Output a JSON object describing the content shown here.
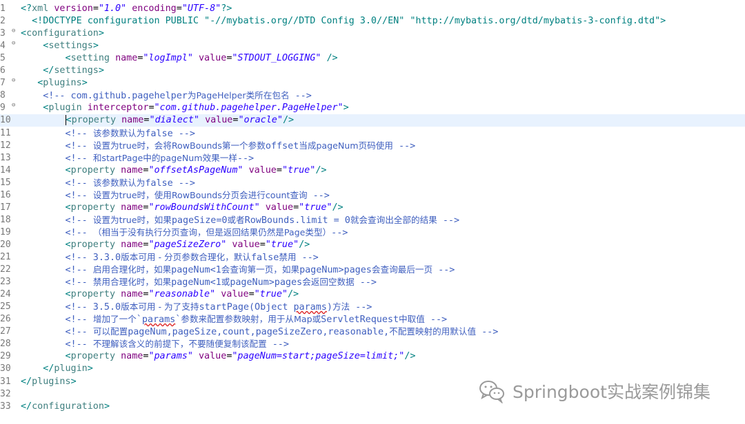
{
  "lines": [
    {
      "n": "1",
      "fold": false,
      "parts": [
        [
          "pi",
          "<?"
        ],
        [
          "tg",
          "xml "
        ],
        [
          "at",
          "version"
        ],
        [
          "tx",
          "="
        ],
        [
          "av",
          "\"1.0\""
        ],
        [
          "tx",
          " "
        ],
        [
          "at",
          "encoding"
        ],
        [
          "tx",
          "="
        ],
        [
          "av",
          "\"UTF-8\""
        ],
        [
          "pi",
          "?>"
        ]
      ]
    },
    {
      "n": "2",
      "fold": false,
      "parts": [
        [
          "tx",
          "  "
        ],
        [
          "dt",
          "<!DOCTYPE configuration PUBLIC "
        ],
        [
          "av2",
          "\"-//mybatis.org//DTD Config 3.0//EN\""
        ],
        [
          "tx",
          " "
        ],
        [
          "av2",
          "\"http://mybatis.org/dtd/mybatis-3-config.dtd\""
        ],
        [
          "dt",
          ">"
        ]
      ]
    },
    {
      "n": "3",
      "fold": true,
      "parts": [
        [
          "br",
          "<"
        ],
        [
          "tg",
          "configuration"
        ],
        [
          "br",
          ">"
        ]
      ]
    },
    {
      "n": "4",
      "fold": true,
      "parts": [
        [
          "tx",
          "    "
        ],
        [
          "br",
          "<"
        ],
        [
          "tg",
          "settings"
        ],
        [
          "br",
          ">"
        ]
      ]
    },
    {
      "n": "5",
      "fold": false,
      "parts": [
        [
          "tx",
          "        "
        ],
        [
          "br",
          "<"
        ],
        [
          "tg",
          "setting "
        ],
        [
          "at",
          "name"
        ],
        [
          "tx",
          "="
        ],
        [
          "av",
          "\"logImpl\""
        ],
        [
          "tx",
          " "
        ],
        [
          "at",
          "value"
        ],
        [
          "tx",
          "="
        ],
        [
          "av",
          "\"STDOUT_LOGGING\""
        ],
        [
          "tx",
          " "
        ],
        [
          "br",
          "/>"
        ]
      ]
    },
    {
      "n": "6",
      "fold": false,
      "parts": [
        [
          "tx",
          "    "
        ],
        [
          "br",
          "</"
        ],
        [
          "tg",
          "settings"
        ],
        [
          "br",
          ">"
        ]
      ]
    },
    {
      "n": "7",
      "fold": true,
      "parts": [
        [
          "tx",
          "   "
        ],
        [
          "br",
          "<"
        ],
        [
          "tg",
          "plugins"
        ],
        [
          "br",
          ">"
        ]
      ]
    },
    {
      "n": "8",
      "fold": false,
      "parts": [
        [
          "tx",
          "    "
        ],
        [
          "cm",
          "<!-- com.github.pagehelper"
        ],
        [
          "cmz",
          "为PageHelper类所在包名"
        ],
        [
          "cm",
          " -->"
        ]
      ]
    },
    {
      "n": "9",
      "fold": true,
      "parts": [
        [
          "tx",
          "    "
        ],
        [
          "br",
          "<"
        ],
        [
          "tg",
          "plugin "
        ],
        [
          "at",
          "interceptor"
        ],
        [
          "tx",
          "="
        ],
        [
          "av",
          "\"com.github.pagehelper.PageHelper\""
        ],
        [
          "br",
          ">"
        ]
      ]
    },
    {
      "n": "10",
      "fold": false,
      "current": true,
      "parts": [
        [
          "tx",
          "        "
        ],
        [
          "caret",
          ""
        ],
        [
          "br",
          "<"
        ],
        [
          "tg",
          "property "
        ],
        [
          "at",
          "name"
        ],
        [
          "tx",
          "="
        ],
        [
          "av",
          "\"dialect\""
        ],
        [
          "tx",
          " "
        ],
        [
          "at",
          "value"
        ],
        [
          "tx",
          "="
        ],
        [
          "av",
          "\"oracle\""
        ],
        [
          "br",
          "/>"
        ]
      ]
    },
    {
      "n": "11",
      "fold": false,
      "parts": [
        [
          "tx",
          "        "
        ],
        [
          "cm",
          "<!-- "
        ],
        [
          "cmz",
          "该参数默认为"
        ],
        [
          "cm",
          "false -->"
        ]
      ]
    },
    {
      "n": "12",
      "fold": false,
      "parts": [
        [
          "tx",
          "        "
        ],
        [
          "cm",
          "<!-- "
        ],
        [
          "cmz",
          "设置为true时，会将RowBounds第一个参数"
        ],
        [
          "cm",
          "offset"
        ],
        [
          "cmz",
          "当成pageNum页码使用"
        ],
        [
          "cm",
          " -->"
        ]
      ]
    },
    {
      "n": "13",
      "fold": false,
      "parts": [
        [
          "tx",
          "        "
        ],
        [
          "cm",
          "<!-- "
        ],
        [
          "cmz",
          "和startPage中的pageNum效果一样"
        ],
        [
          "cm",
          "-->"
        ]
      ]
    },
    {
      "n": "14",
      "fold": false,
      "parts": [
        [
          "tx",
          "        "
        ],
        [
          "br",
          "<"
        ],
        [
          "tg",
          "property "
        ],
        [
          "at",
          "name"
        ],
        [
          "tx",
          "="
        ],
        [
          "av",
          "\"offsetAsPageNum\""
        ],
        [
          "tx",
          " "
        ],
        [
          "at",
          "value"
        ],
        [
          "tx",
          "="
        ],
        [
          "av",
          "\"true\""
        ],
        [
          "br",
          "/>"
        ]
      ]
    },
    {
      "n": "15",
      "fold": false,
      "parts": [
        [
          "tx",
          "        "
        ],
        [
          "cm",
          "<!-- "
        ],
        [
          "cmz",
          "该参数默认为"
        ],
        [
          "cm",
          "false -->"
        ]
      ]
    },
    {
      "n": "16",
      "fold": false,
      "parts": [
        [
          "tx",
          "        "
        ],
        [
          "cm",
          "<!-- "
        ],
        [
          "cmz",
          "设置为true时，使用RowBounds分页会进行count查询"
        ],
        [
          "cm",
          " -->"
        ]
      ]
    },
    {
      "n": "17",
      "fold": false,
      "parts": [
        [
          "tx",
          "        "
        ],
        [
          "br",
          "<"
        ],
        [
          "tg",
          "property "
        ],
        [
          "at",
          "name"
        ],
        [
          "tx",
          "="
        ],
        [
          "av",
          "\"rowBoundsWithCount\""
        ],
        [
          "tx",
          " "
        ],
        [
          "at",
          "value"
        ],
        [
          "tx",
          "="
        ],
        [
          "av",
          "\"true\""
        ],
        [
          "br",
          "/>"
        ]
      ]
    },
    {
      "n": "18",
      "fold": false,
      "parts": [
        [
          "tx",
          "        "
        ],
        [
          "cm",
          "<!-- "
        ],
        [
          "cmz",
          "设置为true时，如果"
        ],
        [
          "cm",
          "pageSize=0"
        ],
        [
          "cmz",
          "或者"
        ],
        [
          "cm",
          "RowBounds.limit = 0"
        ],
        [
          "cmz",
          "就会查询出全部的结果"
        ],
        [
          "cm",
          " -->"
        ]
      ]
    },
    {
      "n": "19",
      "fold": false,
      "parts": [
        [
          "tx",
          "        "
        ],
        [
          "cm",
          "<!-- "
        ],
        [
          "cmz",
          "（相当于没有执行分页查询，但是返回结果仍然是Page类型）"
        ],
        [
          "cm",
          "-->"
        ]
      ]
    },
    {
      "n": "20",
      "fold": false,
      "parts": [
        [
          "tx",
          "        "
        ],
        [
          "br",
          "<"
        ],
        [
          "tg",
          "property "
        ],
        [
          "at",
          "name"
        ],
        [
          "tx",
          "="
        ],
        [
          "av",
          "\"pageSizeZero\""
        ],
        [
          "tx",
          " "
        ],
        [
          "at",
          "value"
        ],
        [
          "tx",
          "="
        ],
        [
          "av",
          "\"true\""
        ],
        [
          "br",
          "/>"
        ]
      ]
    },
    {
      "n": "21",
      "fold": false,
      "parts": [
        [
          "tx",
          "        "
        ],
        [
          "cm",
          "<!-- 3.3.0"
        ],
        [
          "cmz",
          "版本可用 - 分页参数合理化，默认"
        ],
        [
          "cm",
          "false"
        ],
        [
          "cmz",
          "禁用"
        ],
        [
          "cm",
          " -->"
        ]
      ]
    },
    {
      "n": "22",
      "fold": false,
      "parts": [
        [
          "tx",
          "        "
        ],
        [
          "cm",
          "<!-- "
        ],
        [
          "cmz",
          "启用合理化时，如果"
        ],
        [
          "cm",
          "pageNum<1"
        ],
        [
          "cmz",
          "会查询第一页，如果"
        ],
        [
          "cm",
          "pageNum>pages"
        ],
        [
          "cmz",
          "会查询最后一页"
        ],
        [
          "cm",
          " -->"
        ]
      ]
    },
    {
      "n": "23",
      "fold": false,
      "parts": [
        [
          "tx",
          "        "
        ],
        [
          "cm",
          "<!-- "
        ],
        [
          "cmz",
          "禁用合理化时，如果"
        ],
        [
          "cm",
          "pageNum<1"
        ],
        [
          "cmz",
          "或"
        ],
        [
          "cm",
          "pageNum>pages"
        ],
        [
          "cmz",
          "会返回空数据"
        ],
        [
          "cm",
          " -->"
        ]
      ]
    },
    {
      "n": "24",
      "fold": false,
      "parts": [
        [
          "tx",
          "        "
        ],
        [
          "br",
          "<"
        ],
        [
          "tg",
          "property "
        ],
        [
          "at",
          "name"
        ],
        [
          "tx",
          "="
        ],
        [
          "av",
          "\"reasonable\""
        ],
        [
          "tx",
          " "
        ],
        [
          "at",
          "value"
        ],
        [
          "tx",
          "="
        ],
        [
          "av",
          "\"true\""
        ],
        [
          "br",
          "/>"
        ]
      ]
    },
    {
      "n": "25",
      "fold": false,
      "parts": [
        [
          "tx",
          "        "
        ],
        [
          "cm",
          "<!-- 3.5.0"
        ],
        [
          "cmz",
          "版本可用 - 为了支持"
        ],
        [
          "cm",
          "startPage(Object "
        ],
        [
          "cmsq",
          "params"
        ],
        [
          "cm",
          ")"
        ],
        [
          "cmz",
          "方法"
        ],
        [
          "cm",
          " -->"
        ]
      ]
    },
    {
      "n": "26",
      "fold": false,
      "parts": [
        [
          "tx",
          "        "
        ],
        [
          "cm",
          "<!-- "
        ],
        [
          "cmz",
          "增加了一个"
        ],
        [
          "cm",
          "`"
        ],
        [
          "cmsq",
          "params"
        ],
        [
          "cm",
          "`"
        ],
        [
          "cmz",
          "参数来配置参数映射，用于从Map或"
        ],
        [
          "cm",
          "ServletRequest"
        ],
        [
          "cmz",
          "中取值"
        ],
        [
          "cm",
          " -->"
        ]
      ]
    },
    {
      "n": "27",
      "fold": false,
      "parts": [
        [
          "tx",
          "        "
        ],
        [
          "cm",
          "<!-- "
        ],
        [
          "cmz",
          "可以配置"
        ],
        [
          "cm",
          "pageNum,pageSize,count,pageSizeZero,reasonable,"
        ],
        [
          "cmz",
          "不配置映射的用默认值"
        ],
        [
          "cm",
          " -->"
        ]
      ]
    },
    {
      "n": "28",
      "fold": false,
      "parts": [
        [
          "tx",
          "        "
        ],
        [
          "cm",
          "<!-- "
        ],
        [
          "cmz",
          "不理解该含义的前提下，不要随便复制该配置"
        ],
        [
          "cm",
          " -->"
        ]
      ]
    },
    {
      "n": "29",
      "fold": false,
      "parts": [
        [
          "tx",
          "        "
        ],
        [
          "br",
          "<"
        ],
        [
          "tg",
          "property "
        ],
        [
          "at",
          "name"
        ],
        [
          "tx",
          "="
        ],
        [
          "av",
          "\"params\""
        ],
        [
          "tx",
          " "
        ],
        [
          "at",
          "value"
        ],
        [
          "tx",
          "="
        ],
        [
          "av",
          "\"pageNum=start;pageSize=limit;\""
        ],
        [
          "br",
          "/>"
        ]
      ]
    },
    {
      "n": "30",
      "fold": false,
      "parts": [
        [
          "tx",
          "    "
        ],
        [
          "br",
          "</"
        ],
        [
          "tg",
          "plugin"
        ],
        [
          "br",
          ">"
        ]
      ]
    },
    {
      "n": "31",
      "fold": false,
      "parts": [
        [
          "br",
          "</"
        ],
        [
          "tg",
          "plugins"
        ],
        [
          "br",
          ">"
        ]
      ]
    },
    {
      "n": "32",
      "fold": false,
      "parts": []
    },
    {
      "n": "33",
      "fold": false,
      "parts": [
        [
          "br",
          "</"
        ],
        [
          "tg",
          "configuration"
        ],
        [
          "br",
          ">"
        ]
      ]
    }
  ],
  "watermark": {
    "text": "Springboot实战案例锦集",
    "icon": "wechat-icon"
  },
  "colors": {
    "current_line": "#e8f2fe",
    "tag": "#3f7f7f",
    "attribute": "#7f007f",
    "value": "#2a00ff",
    "comment": "#3f5fbf"
  }
}
